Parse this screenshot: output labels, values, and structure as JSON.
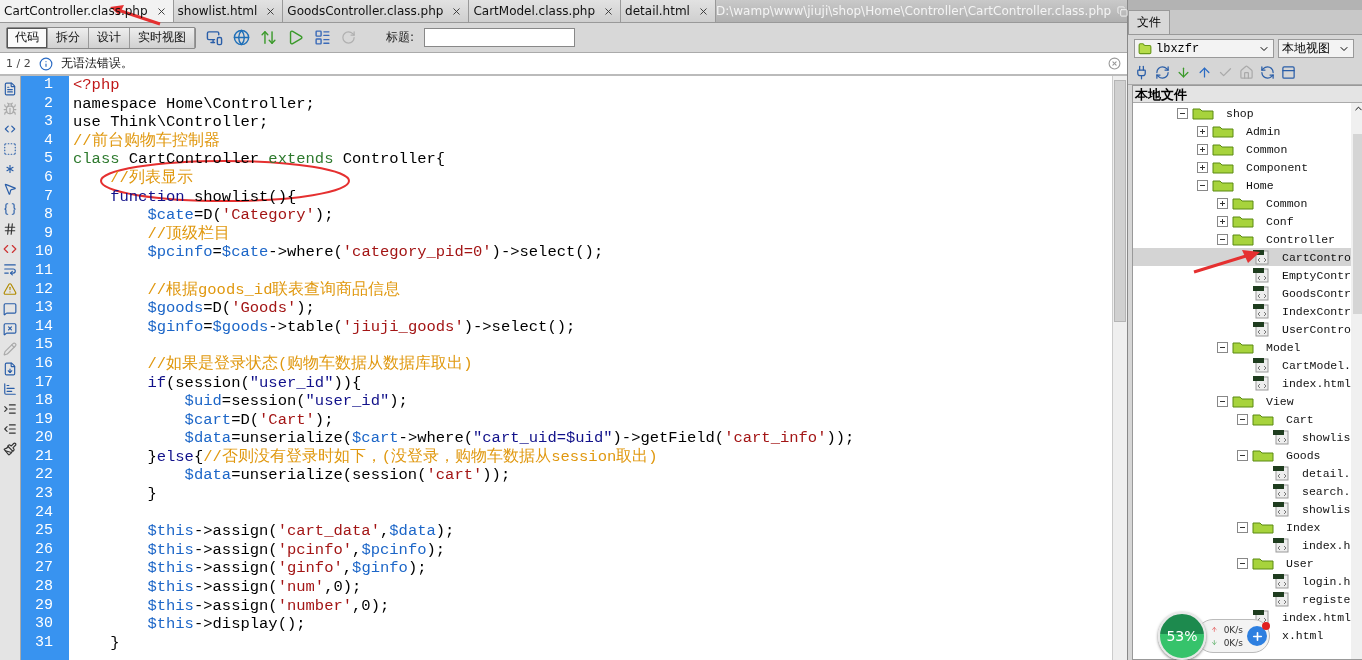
{
  "document_tabs": [
    {
      "label": "CartController.class.php",
      "selected": true
    },
    {
      "label": "showlist.html",
      "selected": false
    },
    {
      "label": "GoodsController.class.php",
      "selected": false
    },
    {
      "label": "CartModel.class.php",
      "selected": false
    },
    {
      "label": "detail.html",
      "selected": false
    }
  ],
  "file_path": "D:\\wamp\\www\\jiuji\\shop\\Home\\Controller\\CartController.class.php",
  "view_buttons": [
    {
      "label": "代码",
      "selected": true
    },
    {
      "label": "拆分",
      "selected": false
    },
    {
      "label": "设计",
      "selected": false
    },
    {
      "label": "实时视图",
      "selected": false
    }
  ],
  "title_field": {
    "label": "标题:"
  },
  "info_bar": {
    "page": "1 / 2",
    "message": "无语法错误。"
  },
  "code_lines": [
    {
      "number": "1",
      "tokens": [
        {
          "kind": "tag",
          "text": "<?php"
        }
      ]
    },
    {
      "number": "2",
      "tokens": [
        {
          "kind": "plain",
          "text": "namespace Home\\Controller;"
        }
      ]
    },
    {
      "number": "3",
      "tokens": [
        {
          "kind": "plain",
          "text": "use Think\\Controller;"
        }
      ]
    },
    {
      "number": "4",
      "tokens": [
        {
          "kind": "comment",
          "text": "//前台购物车控制器"
        }
      ]
    },
    {
      "number": "5",
      "tokens": [
        {
          "kind": "keyword",
          "text": "class"
        },
        {
          "kind": "plain",
          "text": " CartController "
        },
        {
          "kind": "keyword",
          "text": "extends"
        },
        {
          "kind": "plain",
          "text": " Controller{"
        }
      ]
    },
    {
      "number": "6",
      "tokens": [
        {
          "kind": "comment",
          "text": "    //列表显示"
        }
      ]
    },
    {
      "number": "7",
      "tokens": [
        {
          "kind": "reserved",
          "text": "    function"
        },
        {
          "kind": "plain",
          "text": " showlist(){"
        }
      ]
    },
    {
      "number": "8",
      "tokens": [
        {
          "kind": "var",
          "text": "        $cate"
        },
        {
          "kind": "plain",
          "text": "=D("
        },
        {
          "kind": "string",
          "text": "'Category'"
        },
        {
          "kind": "plain",
          "text": ");"
        }
      ]
    },
    {
      "number": "9",
      "tokens": [
        {
          "kind": "comment",
          "text": "        //顶级栏目"
        }
      ]
    },
    {
      "number": "10",
      "tokens": [
        {
          "kind": "var",
          "text": "        $pcinfo"
        },
        {
          "kind": "plain",
          "text": "="
        },
        {
          "kind": "var",
          "text": "$cate"
        },
        {
          "kind": "plain",
          "text": "->where("
        },
        {
          "kind": "string",
          "text": "'category_pid=0'"
        },
        {
          "kind": "plain",
          "text": ")->select();"
        }
      ]
    },
    {
      "number": "11"
    },
    {
      "number": "12",
      "tokens": [
        {
          "kind": "comment",
          "text": "        //根据goods_id联表查询商品信息"
        }
      ]
    },
    {
      "number": "13",
      "tokens": [
        {
          "kind": "var",
          "text": "        $goods"
        },
        {
          "kind": "plain",
          "text": "=D("
        },
        {
          "kind": "string",
          "text": "'Goods'"
        },
        {
          "kind": "plain",
          "text": ");"
        }
      ]
    },
    {
      "number": "14",
      "tokens": [
        {
          "kind": "var",
          "text": "        $ginfo"
        },
        {
          "kind": "plain",
          "text": "="
        },
        {
          "kind": "var",
          "text": "$goods"
        },
        {
          "kind": "plain",
          "text": "->table("
        },
        {
          "kind": "string",
          "text": "'jiuji_goods'"
        },
        {
          "kind": "plain",
          "text": ")->select();"
        }
      ]
    },
    {
      "number": "15"
    },
    {
      "number": "16",
      "tokens": [
        {
          "kind": "comment",
          "text": "        //如果是登录状态(购物车数据从数据库取出)"
        }
      ]
    },
    {
      "number": "17",
      "tokens": [
        {
          "kind": "reserved",
          "text": "        if"
        },
        {
          "kind": "plain",
          "text": "(session("
        },
        {
          "kind": "dstring",
          "text": "\"user_id\""
        },
        {
          "kind": "plain",
          "text": ")){"
        }
      ]
    },
    {
      "number": "18",
      "tokens": [
        {
          "kind": "var",
          "text": "            $uid"
        },
        {
          "kind": "plain",
          "text": "=session("
        },
        {
          "kind": "dstring",
          "text": "\"user_id\""
        },
        {
          "kind": "plain",
          "text": ");"
        }
      ]
    },
    {
      "number": "19",
      "tokens": [
        {
          "kind": "var",
          "text": "            $cart"
        },
        {
          "kind": "plain",
          "text": "=D("
        },
        {
          "kind": "string",
          "text": "'Cart'"
        },
        {
          "kind": "plain",
          "text": ");"
        }
      ]
    },
    {
      "number": "20",
      "tokens": [
        {
          "kind": "var",
          "text": "            $data"
        },
        {
          "kind": "plain",
          "text": "=unserialize("
        },
        {
          "kind": "var",
          "text": "$cart"
        },
        {
          "kind": "plain",
          "text": "->where("
        },
        {
          "kind": "dstring",
          "text": "\"cart_uid=$uid\""
        },
        {
          "kind": "plain",
          "text": ")->getField("
        },
        {
          "kind": "string",
          "text": "'cart_info'"
        },
        {
          "kind": "plain",
          "text": "));"
        }
      ]
    },
    {
      "number": "21",
      "tokens": [
        {
          "kind": "plain",
          "text": "        }"
        },
        {
          "kind": "reserved",
          "text": "else"
        },
        {
          "kind": "plain",
          "text": "{"
        },
        {
          "kind": "comment",
          "text": "//否则没有登录时如下，(没登录，购物车数据从session取出)"
        }
      ]
    },
    {
      "number": "22",
      "tokens": [
        {
          "kind": "var",
          "text": "            $data"
        },
        {
          "kind": "plain",
          "text": "=unserialize(session("
        },
        {
          "kind": "string",
          "text": "'cart'"
        },
        {
          "kind": "plain",
          "text": "));"
        }
      ]
    },
    {
      "number": "23",
      "tokens": [
        {
          "kind": "plain",
          "text": "        }"
        }
      ]
    },
    {
      "number": "24"
    },
    {
      "number": "25",
      "tokens": [
        {
          "kind": "var",
          "text": "        $this"
        },
        {
          "kind": "plain",
          "text": "->assign("
        },
        {
          "kind": "string",
          "text": "'cart_data'"
        },
        {
          "kind": "plain",
          "text": ","
        },
        {
          "kind": "var",
          "text": "$data"
        },
        {
          "kind": "plain",
          "text": ");"
        }
      ]
    },
    {
      "number": "26",
      "tokens": [
        {
          "kind": "var",
          "text": "        $this"
        },
        {
          "kind": "plain",
          "text": "->assign("
        },
        {
          "kind": "string",
          "text": "'pcinfo'"
        },
        {
          "kind": "plain",
          "text": ","
        },
        {
          "kind": "var",
          "text": "$pcinfo"
        },
        {
          "kind": "plain",
          "text": ");"
        }
      ]
    },
    {
      "number": "27",
      "tokens": [
        {
          "kind": "var",
          "text": "        $this"
        },
        {
          "kind": "plain",
          "text": "->assign("
        },
        {
          "kind": "string",
          "text": "'ginfo'"
        },
        {
          "kind": "plain",
          "text": ","
        },
        {
          "kind": "var",
          "text": "$ginfo"
        },
        {
          "kind": "plain",
          "text": ");"
        }
      ]
    },
    {
      "number": "28",
      "tokens": [
        {
          "kind": "var",
          "text": "        $this"
        },
        {
          "kind": "plain",
          "text": "->assign("
        },
        {
          "kind": "string",
          "text": "'num'"
        },
        {
          "kind": "plain",
          "text": ",0);"
        }
      ]
    },
    {
      "number": "29",
      "tokens": [
        {
          "kind": "var",
          "text": "        $this"
        },
        {
          "kind": "plain",
          "text": "->assign("
        },
        {
          "kind": "string",
          "text": "'number'"
        },
        {
          "kind": "plain",
          "text": ",0);"
        }
      ]
    },
    {
      "number": "30",
      "tokens": [
        {
          "kind": "var",
          "text": "        $this"
        },
        {
          "kind": "plain",
          "text": "->display();"
        }
      ]
    },
    {
      "number": "31",
      "tokens": [
        {
          "kind": "plain",
          "text": "    }"
        }
      ]
    }
  ],
  "files_panel": {
    "tab": "文件",
    "site": "lbxzfr",
    "view": "本地视图",
    "header": "本地文件",
    "tree": [
      {
        "kind": "folder",
        "name": "shop",
        "expanded": true,
        "selected": false,
        "children": [
          {
            "kind": "folder",
            "name": "Admin",
            "expanded": false,
            "selected": false
          },
          {
            "kind": "folder",
            "name": "Common",
            "expanded": false,
            "selected": false
          },
          {
            "kind": "folder",
            "name": "Component",
            "expanded": false,
            "selected": false
          },
          {
            "kind": "folder",
            "name": "Home",
            "expanded": true,
            "selected": false,
            "children": [
              {
                "kind": "folder",
                "name": "Common",
                "expanded": false,
                "selected": false
              },
              {
                "kind": "folder",
                "name": "Conf",
                "expanded": false,
                "selected": false
              },
              {
                "kind": "folder",
                "name": "Controller",
                "expanded": true,
                "selected": false,
                "children": [
                  {
                    "kind": "file",
                    "name": "CartContro",
                    "selected": true
                  },
                  {
                    "kind": "file",
                    "name": "EmptyContr",
                    "selected": false
                  },
                  {
                    "kind": "file",
                    "name": "GoodsContr",
                    "selected": false
                  },
                  {
                    "kind": "file",
                    "name": "IndexContr",
                    "selected": false
                  },
                  {
                    "kind": "file",
                    "name": "UserContro",
                    "selected": false
                  }
                ]
              },
              {
                "kind": "folder",
                "name": "Model",
                "expanded": true,
                "selected": false,
                "children": [
                  {
                    "kind": "file",
                    "name": "CartModel.",
                    "selected": false
                  },
                  {
                    "kind": "file",
                    "name": "index.html",
                    "selected": false
                  }
                ]
              },
              {
                "kind": "folder",
                "name": "View",
                "expanded": true,
                "selected": false,
                "children": [
                  {
                    "kind": "folder",
                    "name": "Cart",
                    "expanded": true,
                    "selected": false,
                    "children": [
                      {
                        "kind": "file",
                        "name": "showlis",
                        "selected": false
                      }
                    ]
                  },
                  {
                    "kind": "folder",
                    "name": "Goods",
                    "expanded": true,
                    "selected": false,
                    "children": [
                      {
                        "kind": "file",
                        "name": "detail.",
                        "selected": false
                      },
                      {
                        "kind": "file",
                        "name": "search.",
                        "selected": false
                      },
                      {
                        "kind": "file",
                        "name": "showlis",
                        "selected": false
                      }
                    ]
                  },
                  {
                    "kind": "folder",
                    "name": "Index",
                    "expanded": true,
                    "selected": false,
                    "children": [
                      {
                        "kind": "file",
                        "name": "index.h",
                        "selected": false
                      }
                    ]
                  },
                  {
                    "kind": "folder",
                    "name": "User",
                    "expanded": true,
                    "selected": false,
                    "children": [
                      {
                        "kind": "file",
                        "name": "login.h",
                        "selected": false
                      },
                      {
                        "kind": "file",
                        "name": "registe",
                        "selected": false
                      }
                    ]
                  },
                  {
                    "kind": "file",
                    "name": "index.html",
                    "selected": false
                  },
                  {
                    "kind": "file",
                    "name": "x.html",
                    "selected": false
                  }
                ]
              }
            ]
          }
        ]
      }
    ]
  },
  "speed_widget": {
    "percent": "53%",
    "upload": "0K/s",
    "download": "0K/s"
  }
}
